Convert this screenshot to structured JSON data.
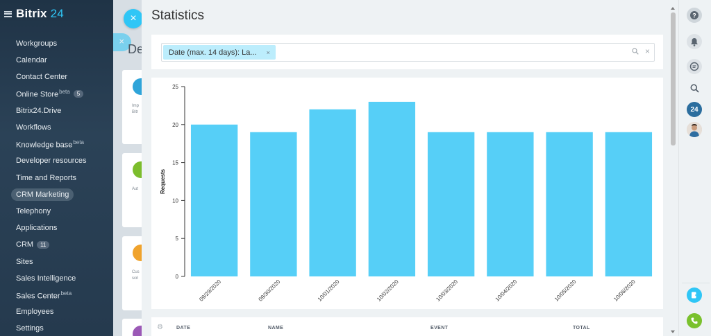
{
  "app": {
    "name": "Bitrix",
    "num": "24"
  },
  "sidebar": {
    "items": [
      {
        "label": "Workgroups"
      },
      {
        "label": "Calendar"
      },
      {
        "label": "Contact Center"
      },
      {
        "label": "Online Store",
        "sup": "beta",
        "count": "5"
      },
      {
        "label": "Bitrix24.Drive"
      },
      {
        "label": "Workflows"
      },
      {
        "label": "Knowledge base",
        "sup": "beta"
      },
      {
        "label": "Developer resources"
      },
      {
        "label": "Time and Reports"
      },
      {
        "label": "CRM Marketing",
        "active": true
      },
      {
        "label": "Telephony"
      },
      {
        "label": "Applications"
      },
      {
        "label": "CRM",
        "count": "11"
      },
      {
        "label": "Sites"
      },
      {
        "label": "Sales Intelligence"
      },
      {
        "label": "Sales Center",
        "sup": "beta"
      },
      {
        "label": "Employees"
      },
      {
        "label": "Settings"
      }
    ]
  },
  "background": {
    "title": "De",
    "cards": [
      {
        "text": "Imp\nBitr",
        "color": "#2fa4d9"
      },
      {
        "text": "Aut",
        "color": "#7cbd2c"
      },
      {
        "text": "Cus\nscri",
        "color": "#f0a32d"
      }
    ]
  },
  "panel": {
    "title": "Statistics",
    "filter": {
      "chip_label": "Date (max. 14 days): La...",
      "chip_close": "×",
      "clear": "×"
    },
    "table_headers": [
      "DATE",
      "NAME",
      "EVENT",
      "TOTAL"
    ]
  },
  "colors": {
    "accent": "#2fc6f6",
    "bar": "#56cff7"
  },
  "chart_data": {
    "type": "bar",
    "categories": [
      "09/29/2020",
      "09/30/2020",
      "10/01/2020",
      "10/02/2020",
      "10/03/2020",
      "10/04/2020",
      "10/05/2020",
      "10/06/2020"
    ],
    "values": [
      20,
      19,
      22,
      23,
      19,
      19,
      19,
      19
    ],
    "ylabel": "Requests",
    "xlabel": "",
    "ylim": [
      0,
      25
    ],
    "yticks": [
      0,
      5,
      10,
      15,
      20,
      25
    ]
  },
  "rail": {
    "icons": [
      "help-icon",
      "bell-icon",
      "chat-icon",
      "search-icon",
      "bitrix24-badge",
      "user-avatar",
      "dialog-icon",
      "phone-icon"
    ],
    "badge": "24"
  }
}
